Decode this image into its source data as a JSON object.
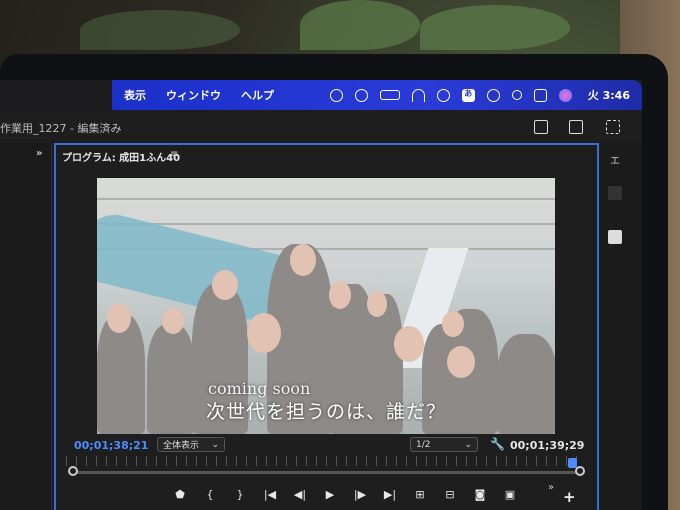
{
  "menubar": {
    "items": [
      "表示",
      "ウィンドウ",
      "ヘルプ"
    ],
    "status_icons": [
      "creative-cloud-icon",
      "play-circle-icon",
      "battery-icon",
      "wifi-icon",
      "download-icon",
      "input-method-icon",
      "time-machine-icon",
      "search-icon",
      "control-center-icon",
      "siri-icon"
    ],
    "ime_glyph": "あ",
    "clock": "火 3:46"
  },
  "app": {
    "project_title": "作業用_1227 - 編集済み",
    "program_panel_title": "プログラム: 成田1ふん40",
    "right_panel_label": "エ"
  },
  "video": {
    "caption_en": "coming soon",
    "caption_jp": "次世代を担うのは、誰だ？"
  },
  "transport": {
    "timecode_current": "00;01;38;21",
    "timecode_duration": "00;01;39;29",
    "zoom_select": "全体表示",
    "resolution_select": "1/2",
    "playhead_fraction": 0.99
  },
  "colors": {
    "menubar_bg": "#2a3bd8",
    "accent_blue": "#4d8cff"
  }
}
